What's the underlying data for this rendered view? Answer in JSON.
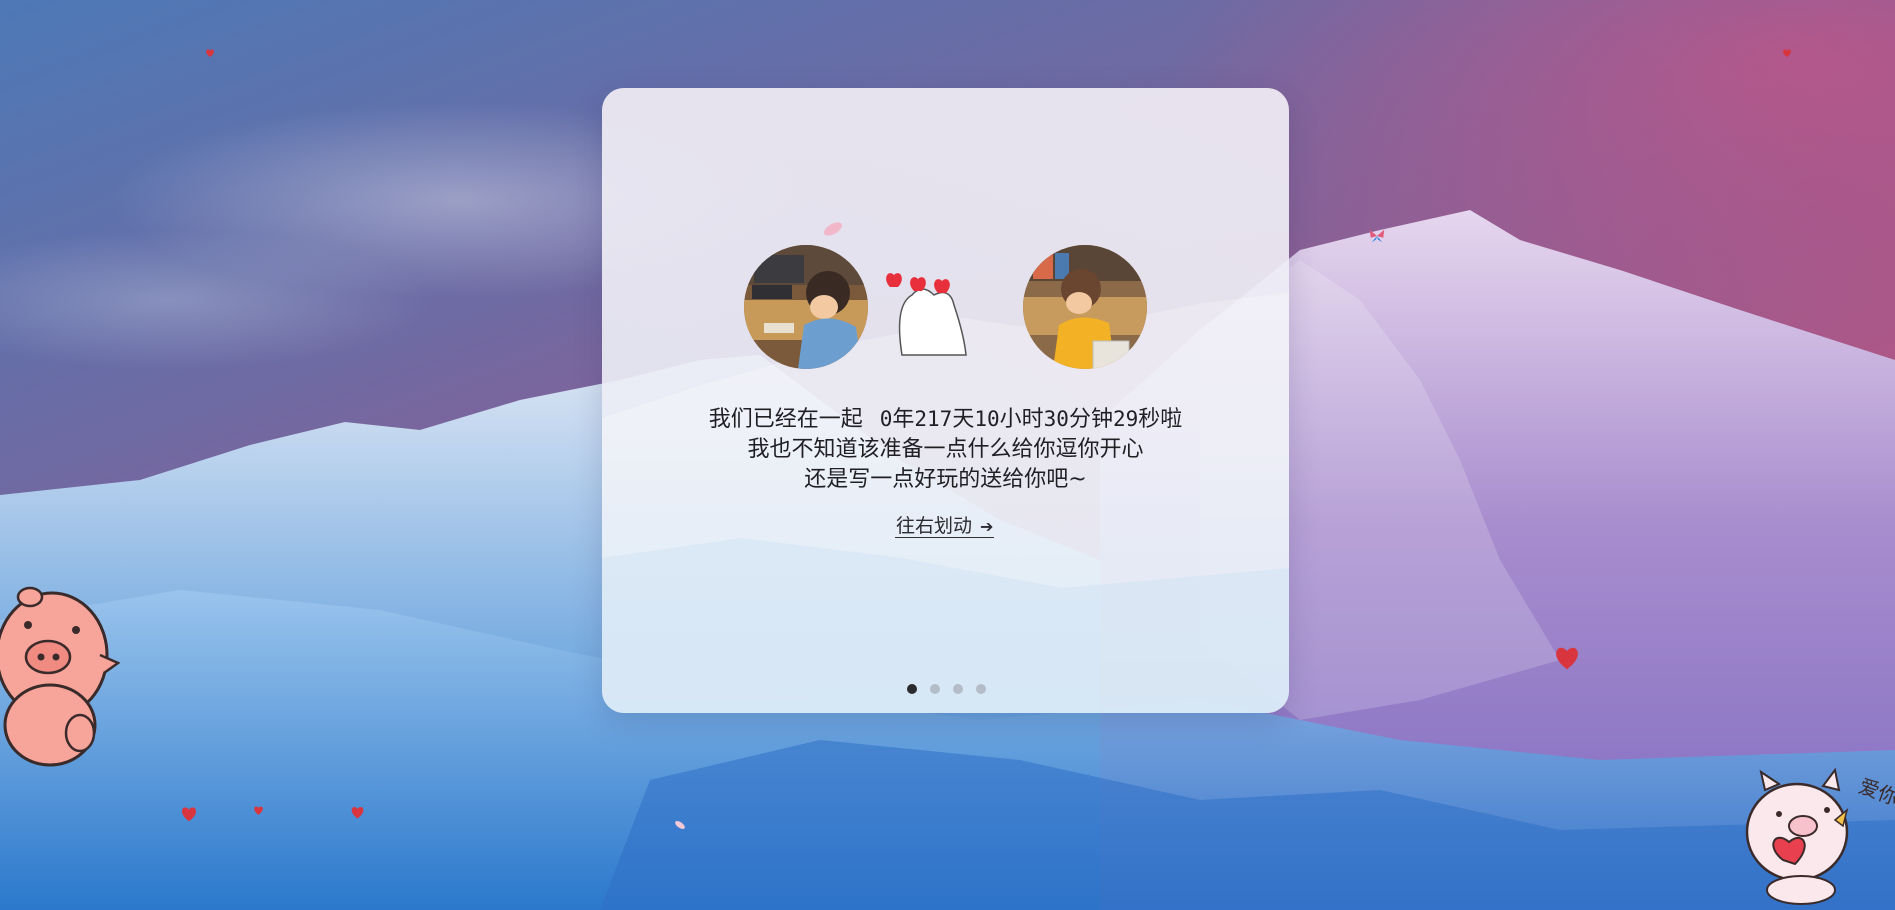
{
  "card": {
    "line1_prefix": "我们已经在一起",
    "counter": {
      "years": "0",
      "years_unit": "年",
      "days": "217",
      "days_unit": "天",
      "hours": "10",
      "hours_unit": "小时",
      "minutes": "30",
      "minutes_unit": "分钟",
      "seconds": "29",
      "seconds_unit": "秒啦"
    },
    "line2": "我也不知道该准备一点什么给你逗你开心",
    "line3": "还是写一点好玩的送给你吧~",
    "swipe_label": "往右划动",
    "arrow_icon": "arrow-right-icon",
    "pager": {
      "total": 4,
      "active_index": 0
    }
  },
  "stickers": {
    "corner_text": "爱你"
  },
  "colors": {
    "heart": "#d8353f",
    "pig_pink": "#f7a59a",
    "dot_active": "#2b2b2f",
    "dot_inactive": "#b3bcc7"
  }
}
